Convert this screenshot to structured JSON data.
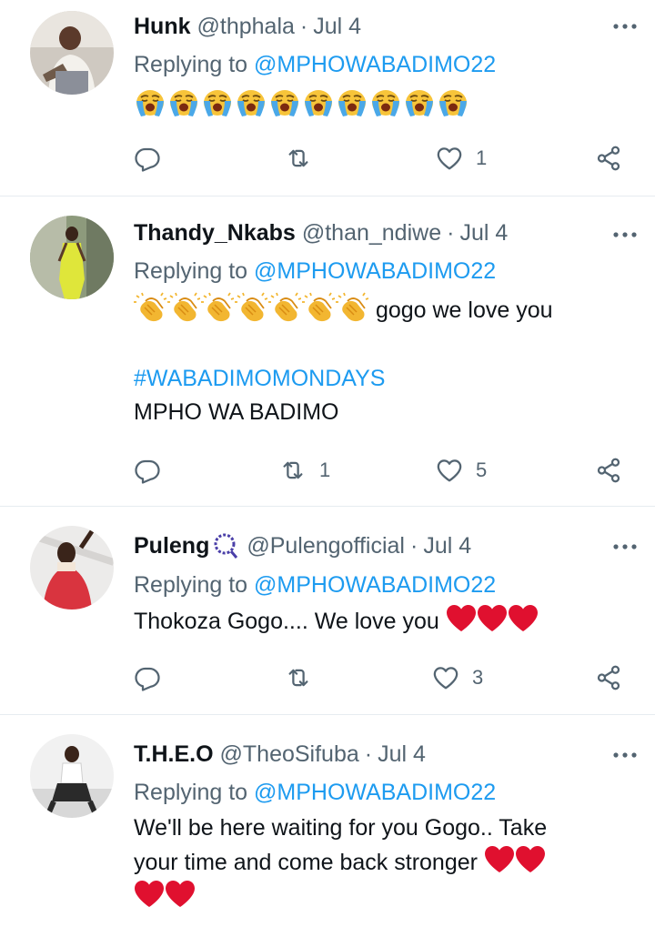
{
  "tweets": [
    {
      "name": "Hunk",
      "handle": "@thphala",
      "separator": "·",
      "date": "Jul 4",
      "reply_prefix": "Replying to ",
      "reply_mention": "@MPHOWABADIMO22",
      "emoji_name": "loudly-crying-face-emoji",
      "emoji_count": 10,
      "text": "",
      "replies": "",
      "retweets": "",
      "likes": "1"
    },
    {
      "name": "Thandy_Nkabs",
      "handle": "@than_ndiwe",
      "separator": "·",
      "date": "Jul 4",
      "reply_prefix": "Replying to ",
      "reply_mention": "@MPHOWABADIMO22",
      "emoji_name": "clapping-hands-emoji",
      "emoji_count": 7,
      "text": " gogo we love you",
      "hashtag": "#WABADIMOMONDAYS",
      "text2": "MPHO WA BADIMO",
      "replies": "",
      "retweets": "1",
      "likes": "5"
    },
    {
      "name": "Puleng",
      "handle": "@Pulengofficial",
      "separator": "·",
      "date": "Jul 4",
      "reply_prefix": "Replying to ",
      "reply_mention": "@MPHOWABADIMO22",
      "text": "Thokoza Gogo.... We love you ",
      "heart_count": 3,
      "replies": "",
      "retweets": "",
      "likes": "3"
    },
    {
      "name": "T.H.E.O",
      "handle": "@TheoSifuba",
      "separator": "·",
      "date": "Jul 4",
      "reply_prefix": "Replying to ",
      "reply_mention": "@MPHOWABADIMO22",
      "text_line1": "We'll be here waiting for you Gogo.. Take",
      "text_line2": "your time and come back stronger "
    }
  ],
  "icons": {
    "reply": "reply-icon",
    "retweet": "retweet-icon",
    "like": "like-icon",
    "share": "share-icon",
    "more": "more-icon"
  },
  "colors": {
    "link": "#1d9bf0",
    "secondary": "#536471",
    "heart": "#e0102f"
  }
}
